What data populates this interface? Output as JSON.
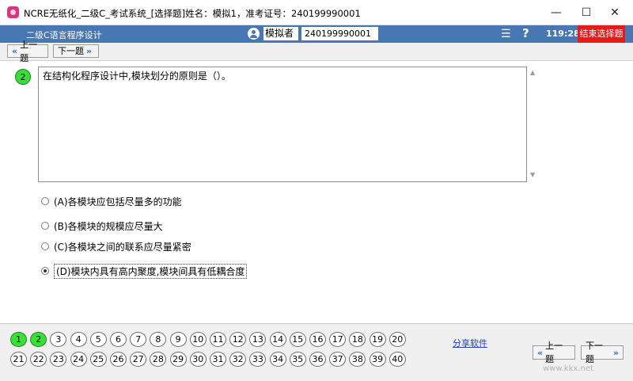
{
  "window": {
    "title": "NCRE无纸化_二级C_考试系统_[选择题]姓名：模拟1，准考证号：240199990001",
    "minimize_glyph": "—",
    "maximize_glyph": "☐",
    "close_glyph": "✕"
  },
  "header": {
    "subject": "二级C语言程序设计",
    "candidate_name": "模拟者",
    "candidate_id": "240199990001",
    "list_glyph": "☰",
    "help_glyph": "?",
    "timer": "119:28",
    "end_label": "结束选择题",
    "bar_color": "#4877b4",
    "end_color": "#e21b1b"
  },
  "nav": {
    "prev_label": "上一题",
    "next_label": "下一题",
    "prev_arrow": "«",
    "next_arrow": "»"
  },
  "question": {
    "number": "2",
    "text": "在结构化程序设计中,模块划分的原则是（）。"
  },
  "options": [
    {
      "label": "(A)各模块应包括尽量多的功能",
      "selected": false
    },
    {
      "label": "(B)各模块的规模应尽量大",
      "selected": false
    },
    {
      "label": "(C)各模块之间的联系应尽量紧密",
      "selected": false
    },
    {
      "label": "(D)模块内具有高内聚度,模块间具有低耦合度",
      "selected": true
    }
  ],
  "question_grid": {
    "row1": [
      "1",
      "2",
      "3",
      "4",
      "5",
      "6",
      "7",
      "8",
      "9",
      "10",
      "11",
      "12",
      "13",
      "14",
      "15",
      "16",
      "17",
      "18",
      "19",
      "20"
    ],
    "row2": [
      "21",
      "22",
      "23",
      "24",
      "25",
      "26",
      "27",
      "28",
      "29",
      "30",
      "31",
      "32",
      "33",
      "34",
      "35",
      "36",
      "37",
      "38",
      "39",
      "40"
    ],
    "answered": [
      "1",
      "2"
    ],
    "answered_color": "#35e335"
  },
  "share_link": "分享软件",
  "watermark": "www.kkx.net"
}
